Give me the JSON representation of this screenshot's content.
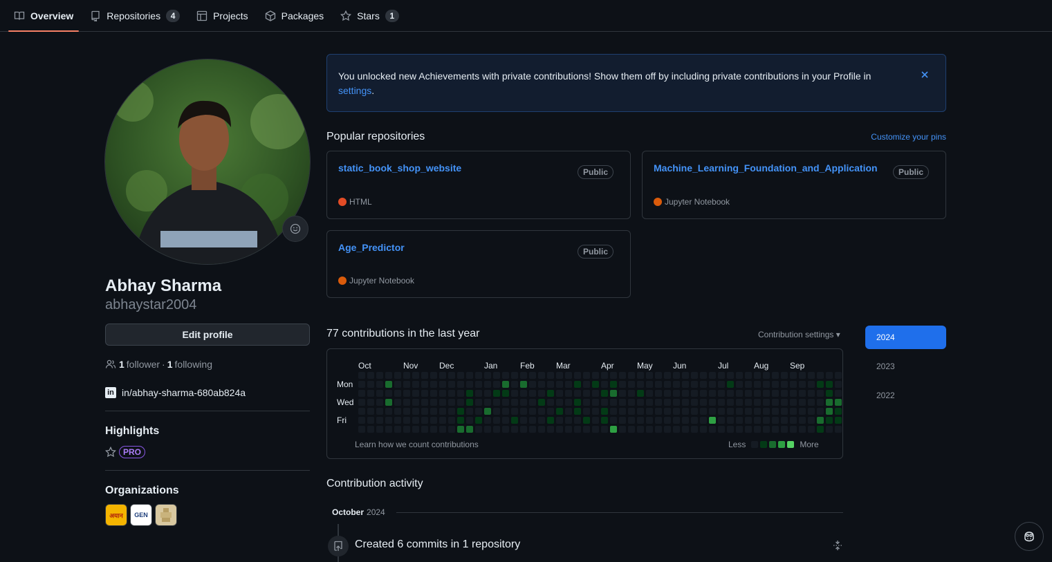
{
  "nav": {
    "tabs": [
      {
        "label": "Overview",
        "icon": "book-icon",
        "active": true
      },
      {
        "label": "Repositories",
        "icon": "repo-icon",
        "count": "4"
      },
      {
        "label": "Projects",
        "icon": "table-icon"
      },
      {
        "label": "Packages",
        "icon": "package-icon"
      },
      {
        "label": "Stars",
        "icon": "star-icon",
        "count": "1"
      }
    ]
  },
  "profile": {
    "name": "Abhay Sharma",
    "username": "abhaystar2004",
    "edit_label": "Edit profile",
    "followers": "1",
    "followers_label": "follower",
    "following": "1",
    "following_label": "following",
    "separator": "·",
    "linkedin": "in/abhay-sharma-680ab824a",
    "highlights_heading": "Highlights",
    "pro_label": "PRO",
    "organizations_heading": "Organizations",
    "orgs": [
      {
        "label": "अयान",
        "bg": "#f4b400"
      },
      {
        "label": "GEN",
        "bg": "#ffffff"
      },
      {
        "label": "",
        "bg": "#d8c8a0"
      }
    ]
  },
  "banner": {
    "text": "You unlocked new Achievements with private contributions! Show them off by including private contributions in your Profile in",
    "link": "settings",
    "end": "."
  },
  "popular": {
    "heading": "Popular repositories",
    "customize": "Customize your pins",
    "repos": [
      {
        "name": "static_book_shop_website",
        "visibility": "Public",
        "language": "HTML",
        "lang_color": "#e34c26"
      },
      {
        "name": "Machine_Learning_Foundation_and_Application",
        "visibility": "Public",
        "language": "Jupyter Notebook",
        "lang_color": "#da5b0b"
      },
      {
        "name": "Age_Predictor",
        "visibility": "Public",
        "language": "Jupyter Notebook",
        "lang_color": "#da5b0b"
      }
    ]
  },
  "contributions": {
    "heading": "77 contributions in the last year",
    "settings_label": "Contribution settings ▾",
    "months": [
      "Oct",
      "Nov",
      "Dec",
      "Jan",
      "Feb",
      "Mar",
      "Apr",
      "May",
      "Jun",
      "Jul",
      "Aug",
      "Sep"
    ],
    "month_weeks": [
      0,
      5,
      9,
      14,
      18,
      22,
      27,
      31,
      35,
      40,
      44,
      48
    ],
    "days": [
      "Mon",
      "Wed",
      "Fri"
    ],
    "learn_label": "Learn how we count contributions",
    "less": "Less",
    "more": "More",
    "levels": [
      "#151b23",
      "#033a16",
      "#196c2e",
      "#2ea043",
      "#56d364"
    ],
    "weeks": 53,
    "active": [
      [
        3,
        1,
        2
      ],
      [
        3,
        3,
        2
      ],
      [
        11,
        4,
        1
      ],
      [
        11,
        5,
        1
      ],
      [
        11,
        6,
        2
      ],
      [
        12,
        2,
        1
      ],
      [
        12,
        3,
        1
      ],
      [
        12,
        6,
        2
      ],
      [
        13,
        5,
        1
      ],
      [
        14,
        4,
        2
      ],
      [
        15,
        2,
        1
      ],
      [
        16,
        1,
        2
      ],
      [
        16,
        2,
        1
      ],
      [
        17,
        5,
        1
      ],
      [
        18,
        1,
        2
      ],
      [
        20,
        3,
        1
      ],
      [
        21,
        2,
        1
      ],
      [
        21,
        5,
        1
      ],
      [
        22,
        4,
        1
      ],
      [
        24,
        1,
        1
      ],
      [
        24,
        3,
        1
      ],
      [
        24,
        4,
        1
      ],
      [
        25,
        5,
        1
      ],
      [
        26,
        1,
        1
      ],
      [
        27,
        2,
        1
      ],
      [
        27,
        4,
        1
      ],
      [
        27,
        5,
        1
      ],
      [
        28,
        1,
        1
      ],
      [
        28,
        2,
        2
      ],
      [
        28,
        6,
        3
      ],
      [
        31,
        2,
        1
      ],
      [
        39,
        5,
        3
      ],
      [
        41,
        1,
        1
      ],
      [
        51,
        1,
        1
      ],
      [
        51,
        5,
        2
      ],
      [
        51,
        6,
        1
      ],
      [
        51,
        7,
        1
      ],
      [
        52,
        1,
        1
      ],
      [
        52,
        2,
        1
      ],
      [
        52,
        3,
        2
      ],
      [
        52,
        4,
        2
      ],
      [
        52,
        5,
        1
      ],
      [
        53,
        3,
        2
      ],
      [
        53,
        4,
        1
      ],
      [
        53,
        5,
        1
      ]
    ]
  },
  "years": [
    "2024",
    "2023",
    "2022"
  ],
  "activity": {
    "heading": "Contribution activity",
    "month": "October",
    "year": "2024",
    "commit_text": "Created 6 commits in 1 repository"
  }
}
